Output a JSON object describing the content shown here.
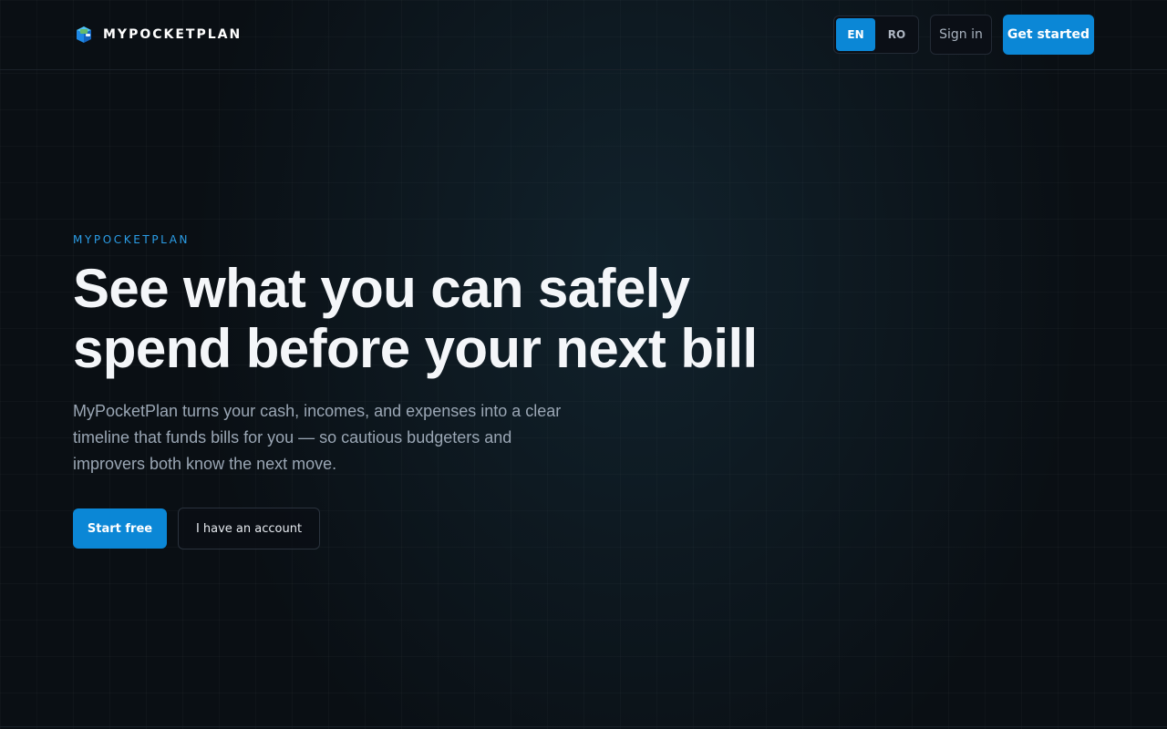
{
  "brand": {
    "name": "MYPOCKETPLAN",
    "logo_icon": "wallet-cube-icon"
  },
  "header": {
    "languages": [
      {
        "code": "EN",
        "active": true
      },
      {
        "code": "RO",
        "active": false
      }
    ],
    "sign_in_label": "Sign in",
    "get_started_label": "Get started"
  },
  "hero": {
    "eyebrow": "MYPOCKETPLAN",
    "headline_lines": [
      "See what you can safely",
      "spend before your next bill"
    ],
    "subtext_lines": [
      "MyPocketPlan turns your cash, incomes, and expenses into a clear",
      "timeline that funds bills for you — so cautious budgeters and",
      "improvers both know the next move."
    ],
    "primary_cta": "Start free",
    "secondary_cta": "I have an account"
  },
  "colors": {
    "background": "#0a0f14",
    "accent": "#0b87d6",
    "eyebrow": "#2b9ee8",
    "subtext": "#9aa6b4"
  }
}
